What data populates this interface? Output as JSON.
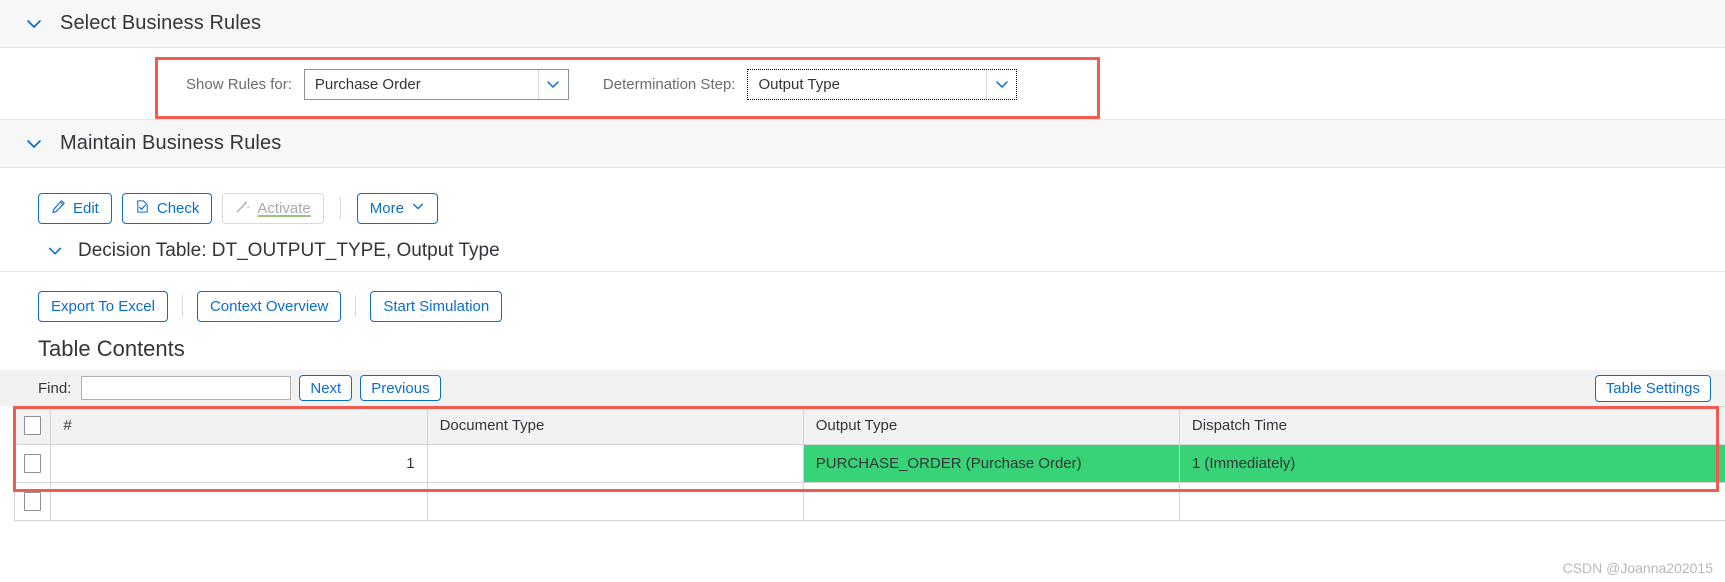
{
  "sections": {
    "select_business_rules": {
      "title": "Select Business Rules"
    },
    "maintain_business_rules": {
      "title": "Maintain Business Rules"
    },
    "decision_table": {
      "title": "Decision Table: DT_OUTPUT_TYPE, Output Type"
    }
  },
  "filters": {
    "show_rules_for": {
      "label": "Show Rules for:",
      "value": "Purchase Order"
    },
    "determination_step": {
      "label": "Determination Step:",
      "value": "Output Type"
    }
  },
  "toolbar": {
    "edit": "Edit",
    "check": "Check",
    "activate": "Activate",
    "more": "More"
  },
  "table_actions": {
    "export_to_excel": "Export To Excel",
    "context_overview": "Context Overview",
    "start_simulation": "Start Simulation"
  },
  "table_contents": {
    "title": "Table Contents",
    "find_label": "Find:",
    "find_value": "",
    "find_placeholder": "",
    "next": "Next",
    "previous": "Previous",
    "table_settings": "Table Settings"
  },
  "decision_table_grid": {
    "columns": [
      "#",
      "Document Type",
      "Output Type",
      "Dispatch Time"
    ],
    "rows": [
      {
        "num": "1",
        "document_type": "",
        "output_type": "PURCHASE_ORDER (Purchase Order)",
        "dispatch_time": "1 (Immediately)",
        "highlight": true
      }
    ]
  },
  "watermark": "CSDN @Joanna202015",
  "colors": {
    "accent": "#0a6ed1",
    "highlight_red": "#f05c52",
    "cell_green": "#39d377",
    "label_grey": "#6a6d70"
  }
}
